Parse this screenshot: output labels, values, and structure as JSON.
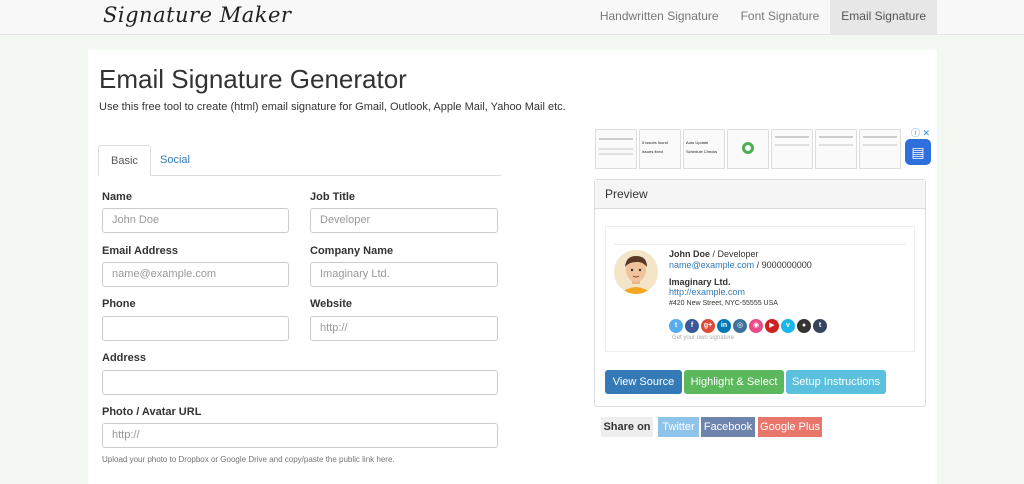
{
  "nav": {
    "brand": "Signature Maker",
    "items": [
      "Handwritten Signature",
      "Font Signature",
      "Email Signature"
    ]
  },
  "page": {
    "title": "Email Signature Generator",
    "lead": "Use this free tool to create (html) email signature for Gmail, Outlook, Apple Mail, Yahoo Mail etc."
  },
  "tabs": [
    "Basic",
    "Social"
  ],
  "form": {
    "name_label": "Name",
    "name_value": "John Doe",
    "job_label": "Job Title",
    "job_value": "Developer",
    "email_label": "Email Address",
    "email_value": "name@example.com",
    "company_label": "Company Name",
    "company_value": "Imaginary Ltd.",
    "phone_label": "Phone",
    "phone_value": "",
    "website_label": "Website",
    "website_value": "http://",
    "address_label": "Address",
    "address_value": "",
    "photo_label": "Photo / Avatar URL",
    "photo_value": "http://",
    "photo_help": "Upload your photo to Dropbox or Google Drive and copy/paste the public link here."
  },
  "ad": {
    "thumb1": "5 issues found",
    "thumb1b": "issues fixed",
    "thumb2": "Auto Update",
    "thumb2b": "Schedule Checks",
    "info": "ⓘ ✕"
  },
  "preview": {
    "heading": "Preview",
    "name": "John Doe",
    "title": " / Developer",
    "email": "name@example.com",
    "phone": " / 9000000000",
    "company": "Imaginary Ltd.",
    "website": "http://example.com",
    "address": "#420 New Street, NYC-55555 USA",
    "footer": "Get your own signature"
  },
  "socials": [
    {
      "icon": "twitter-icon",
      "glyph": "t",
      "color": "#55acee"
    },
    {
      "icon": "facebook-icon",
      "glyph": "f",
      "color": "#3b5998"
    },
    {
      "icon": "google-plus-icon",
      "glyph": "g+",
      "color": "#dd4b39"
    },
    {
      "icon": "linkedin-icon",
      "glyph": "in",
      "color": "#0077b5"
    },
    {
      "icon": "instagram-icon",
      "glyph": "◎",
      "color": "#3f729b"
    },
    {
      "icon": "dribbble-icon",
      "glyph": "◉",
      "color": "#ea4c89"
    },
    {
      "icon": "youtube-icon",
      "glyph": "▶",
      "color": "#cd201f"
    },
    {
      "icon": "vimeo-icon",
      "glyph": "v",
      "color": "#1ab7ea"
    },
    {
      "icon": "github-icon",
      "glyph": "●",
      "color": "#333333"
    },
    {
      "icon": "tumblr-icon",
      "glyph": "t",
      "color": "#35465c"
    }
  ],
  "buttons": {
    "view_source": "View Source",
    "highlight": "Highlight & Select",
    "setup": "Setup Instructions"
  },
  "share": {
    "label": "Share on",
    "twitter": "Twitter",
    "facebook": "Facebook",
    "google": "Google Plus"
  },
  "colors": {
    "primary": "#337ab7",
    "success": "#5cb85c",
    "info": "#5bc0de",
    "twitter": "#8fc4ea",
    "facebook": "#6f84ad",
    "google": "#e8766a"
  }
}
